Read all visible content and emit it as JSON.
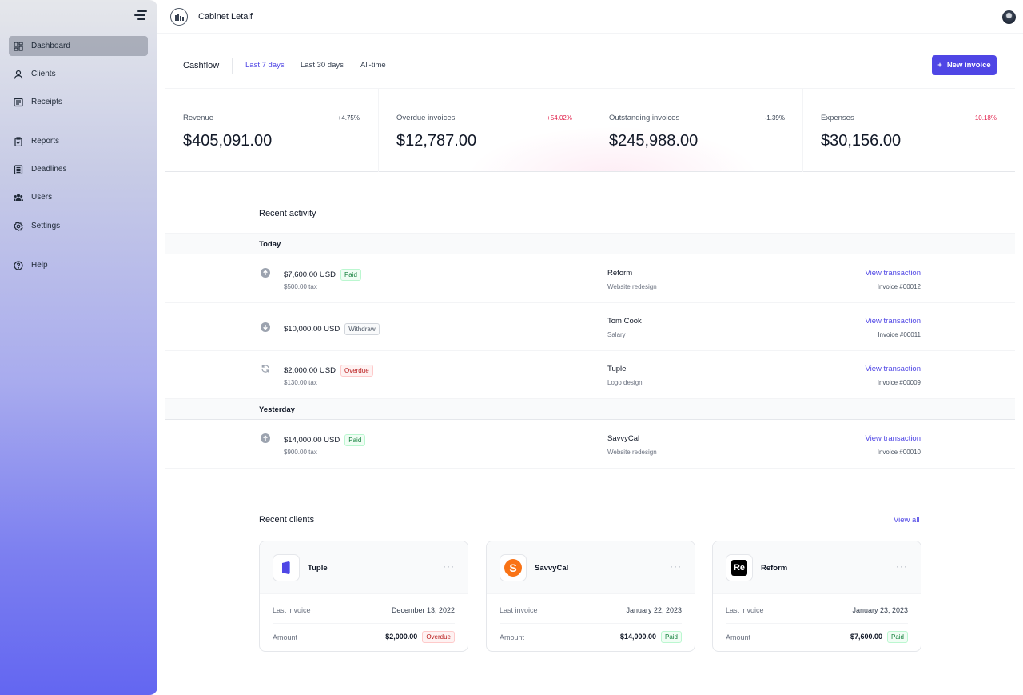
{
  "app": {
    "name": "Cabinet Letaif"
  },
  "sidebar": {
    "items": [
      {
        "label": "Dashboard",
        "icon": "dashboard-icon",
        "active": true
      },
      {
        "label": "Clients",
        "icon": "user-icon"
      },
      {
        "label": "Receipts",
        "icon": "receipt-icon"
      },
      {
        "label": "Reports",
        "icon": "clipboard-icon"
      },
      {
        "label": "Deadlines",
        "icon": "calendar-icon"
      },
      {
        "label": "Users",
        "icon": "users-icon"
      },
      {
        "label": "Settings",
        "icon": "gear-icon"
      },
      {
        "label": "Help",
        "icon": "help-icon"
      }
    ]
  },
  "cashflow": {
    "title": "Cashflow",
    "tabs": [
      "Last 7 days",
      "Last 30 days",
      "All-time"
    ],
    "active_tab": "Last 7 days",
    "new_invoice_label": "New invoice"
  },
  "stats": [
    {
      "label": "Revenue",
      "change": "+4.75%",
      "value": "$405,091.00"
    },
    {
      "label": "Overdue invoices",
      "change": "+54.02%",
      "value": "$12,787.00"
    },
    {
      "label": "Outstanding invoices",
      "change": "-1.39%",
      "value": "$245,988.00"
    },
    {
      "label": "Expenses",
      "change": "+10.18%",
      "value": "$30,156.00"
    }
  ],
  "activity": {
    "title": "Recent activity",
    "groups": [
      {
        "label": "Today"
      },
      {
        "label": "Yesterday"
      }
    ],
    "transactions": [
      {
        "amount": "$7,600.00 USD",
        "status": "Paid",
        "tax": "$500.00 tax",
        "client": "Reform",
        "description": "Website redesign",
        "link": "View transaction",
        "invoice": "Invoice #00012",
        "icon": "arrow-up-circle-icon"
      },
      {
        "amount": "$10,000.00 USD",
        "status": "Withdraw",
        "tax": "",
        "client": "Tom Cook",
        "description": "Salary",
        "link": "View transaction",
        "invoice": "Invoice #00011",
        "icon": "arrow-down-circle-icon"
      },
      {
        "amount": "$2,000.00 USD",
        "status": "Overdue",
        "tax": "$130.00 tax",
        "client": "Tuple",
        "description": "Logo design",
        "link": "View transaction",
        "invoice": "Invoice #00009",
        "icon": "refresh-icon"
      },
      {
        "amount": "$14,000.00 USD",
        "status": "Paid",
        "tax": "$900.00 tax",
        "client": "SavvyCal",
        "description": "Website redesign",
        "link": "View transaction",
        "invoice": "Invoice #00010",
        "icon": "arrow-up-circle-icon"
      }
    ]
  },
  "clients": {
    "title": "Recent clients",
    "view_all": "View all",
    "items": [
      {
        "name": "Tuple",
        "last_invoice_label": "Last invoice",
        "last_invoice": "December 13, 2022",
        "amount_label": "Amount",
        "amount": "$2,000.00",
        "status": "Overdue",
        "logo_text": "",
        "color": "#4f46e5"
      },
      {
        "name": "SavvyCal",
        "last_invoice_label": "Last invoice",
        "last_invoice": "January 22, 2023",
        "amount_label": "Amount",
        "amount": "$14,000.00",
        "status": "Paid",
        "logo_text": "S",
        "color": "#f97316"
      },
      {
        "name": "Reform",
        "last_invoice_label": "Last invoice",
        "last_invoice": "January 23, 2023",
        "amount_label": "Amount",
        "amount": "$7,600.00",
        "status": "Paid",
        "logo_text": "Re",
        "color": "#000000"
      }
    ]
  }
}
